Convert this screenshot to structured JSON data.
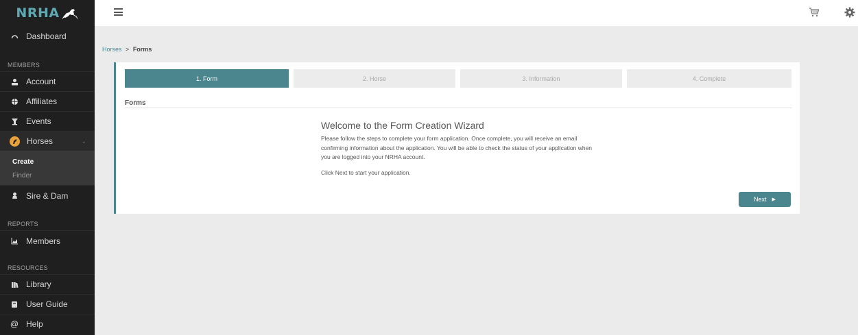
{
  "sidebar": {
    "logo": "NRHA",
    "dashboard": "Dashboard",
    "section_members": "MEMBERS",
    "account": "Account",
    "affiliates": "Affiliates",
    "events": "Events",
    "horses": "Horses",
    "horses_sub": [
      "Create",
      "Finder"
    ],
    "sire_dam": "Sire & Dam",
    "section_reports": "REPORTS",
    "members": "Members",
    "section_resources": "RESOURCES",
    "library": "Library",
    "user_guide": "User Guide",
    "help": "Help",
    "accent_color": "#e8a23b"
  },
  "breadcrumb": {
    "parent": "Horses",
    "separator": ">",
    "current": "Forms"
  },
  "wizard": {
    "steps": [
      "1. Form",
      "2. Horse",
      "3. Information",
      "4. Complete"
    ],
    "active_step": 1,
    "section_title": "Forms",
    "title": "Welcome to the Form Creation Wizard",
    "body": "Please follow the steps to complete your form application. Once complete, you will receive an email confirming information about the application. You will be able to check the status of your application when you are logged into your NRHA account.",
    "hint": "Click Next to start your application.",
    "next_label": "Next",
    "accent_color": "#4b868e"
  }
}
